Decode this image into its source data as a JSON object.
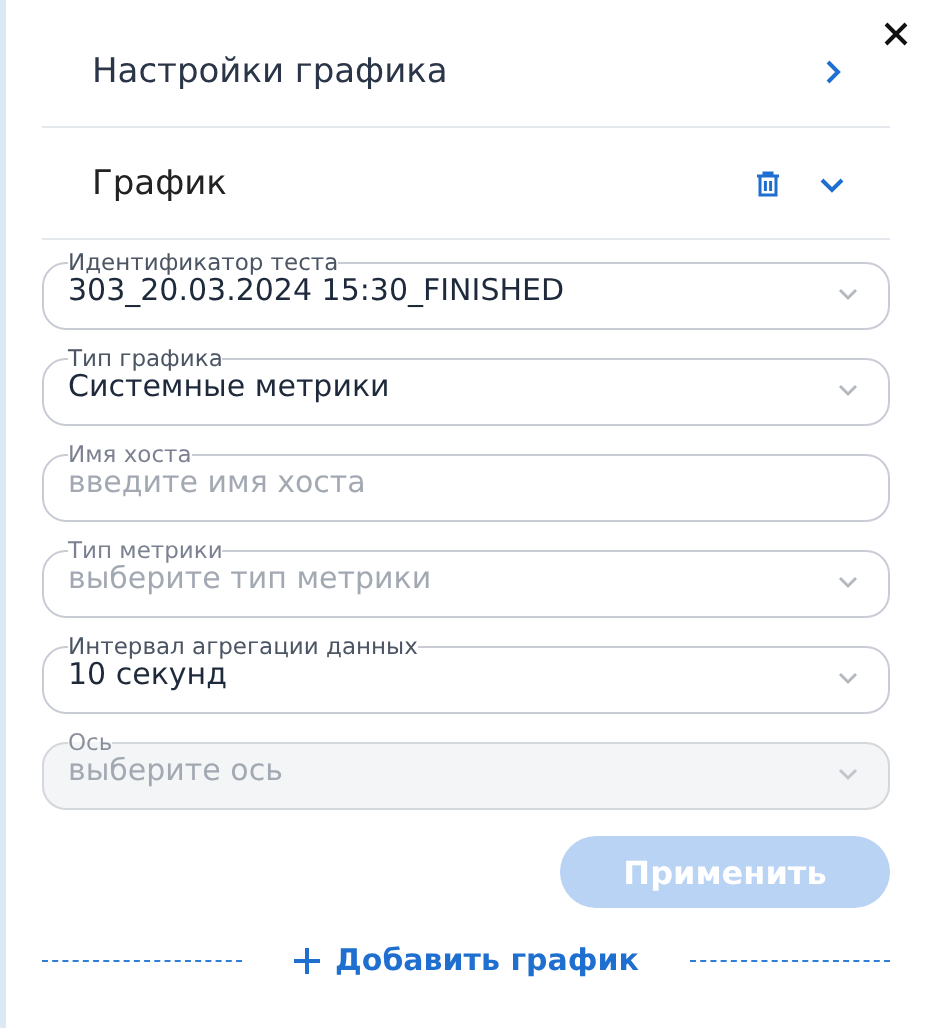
{
  "sections": [
    {
      "title": "Настройки графика",
      "expanded": false,
      "deletable": false
    },
    {
      "title": "График",
      "expanded": true,
      "deletable": true
    }
  ],
  "fields": [
    {
      "kind": "select",
      "label": "Идентификатор теста",
      "value": "303_20.03.2024 15:30_FINISHED",
      "disabled": false
    },
    {
      "kind": "select",
      "label": "Тип графика",
      "value": "Системные метрики",
      "disabled": false
    },
    {
      "kind": "input",
      "label": "Имя хоста",
      "placeholder": "введите имя хоста",
      "disabled": false
    },
    {
      "kind": "select",
      "label": "Тип метрики",
      "placeholder": "выберите тип метрики",
      "disabled": false
    },
    {
      "kind": "select",
      "label": "Интервал агрегации данных",
      "value": "10 секунд",
      "disabled": false
    },
    {
      "kind": "select",
      "label": "Ось",
      "placeholder": "выберите ось",
      "disabled": true
    }
  ],
  "apply_button": {
    "label": "Применить",
    "disabled": true
  },
  "add_link": {
    "label": "Добавить график"
  }
}
